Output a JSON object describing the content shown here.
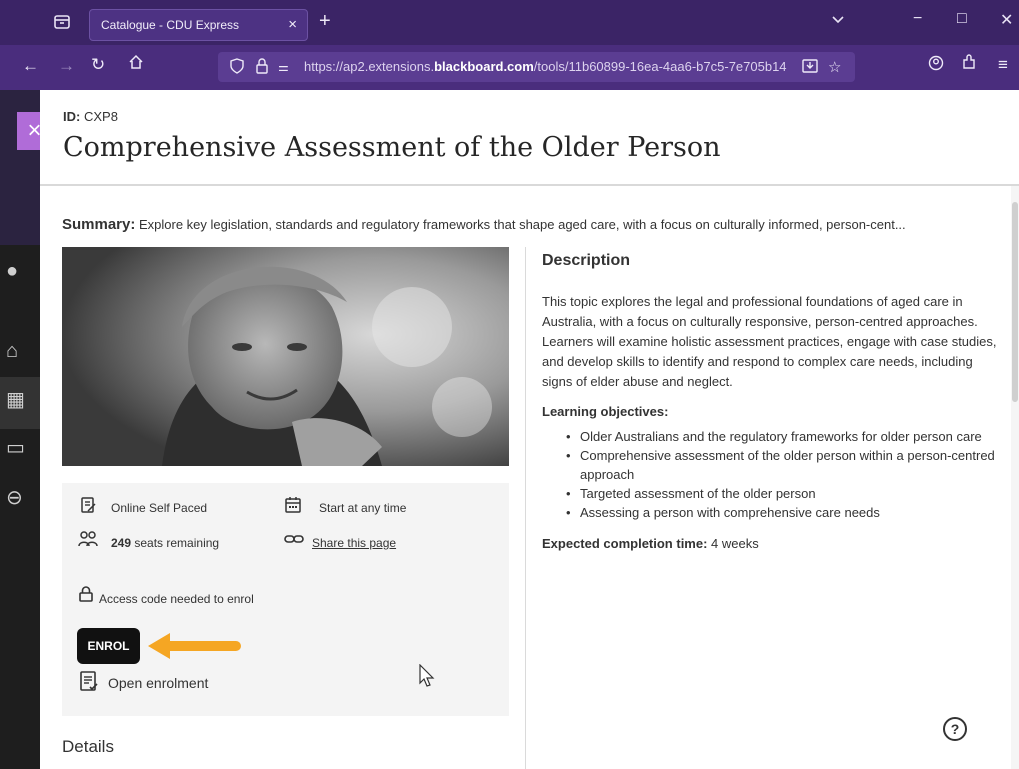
{
  "browser": {
    "tab_title": "Catalogue - CDU Express",
    "tab_close": "×",
    "new_tab": "+",
    "url_prefix": "https://ap2.extensions.",
    "url_domain": "blackboard.com",
    "url_path": "/tools/11b60899-16ea-4aa6-b7c5-7e705b14",
    "window_minimize": "−",
    "window_maximize": "□",
    "window_close": "✕"
  },
  "panel": {
    "close_label": "×",
    "id_label": "ID:",
    "id_value": "CXP8",
    "title": "Comprehensive Assessment of the Older Person",
    "summary_label": "Summary:",
    "summary_text": "Explore key legislation, standards and regulatory frameworks that shape aged care, with a focus on culturally informed, person-cent..."
  },
  "info": {
    "delivery": "Online Self Paced",
    "start": "Start at any time",
    "seats_count": "249",
    "seats_text": "seats remaining",
    "share": "Share this page",
    "access_code": "Access code needed to enrol",
    "enrol_button": "ENROL",
    "open_enrolment": "Open enrolment"
  },
  "details_heading": "Details",
  "description": {
    "heading": "Description",
    "body": "This topic explores the legal and professional foundations of aged care in Australia, with a focus on culturally responsive, person-centred approaches. Learners will examine holistic assessment practices, engage with case studies, and develop skills to identify and respond to complex care needs, including signs of elder abuse and neglect.",
    "objectives_heading": "Learning objectives:",
    "objectives": [
      "Older Australians and the regulatory frameworks for older person care",
      "Comprehensive assessment of the older person within a person-centred approach",
      "Targeted assessment of the older person",
      "Assessing a person with comprehensive care needs"
    ],
    "completion_label": "Expected completion time:",
    "completion_value": "4 weeks"
  },
  "help_label": "?",
  "colors": {
    "accent": "#b06cd8",
    "arrow": "#f5a623",
    "chrome": "#3b2466"
  }
}
